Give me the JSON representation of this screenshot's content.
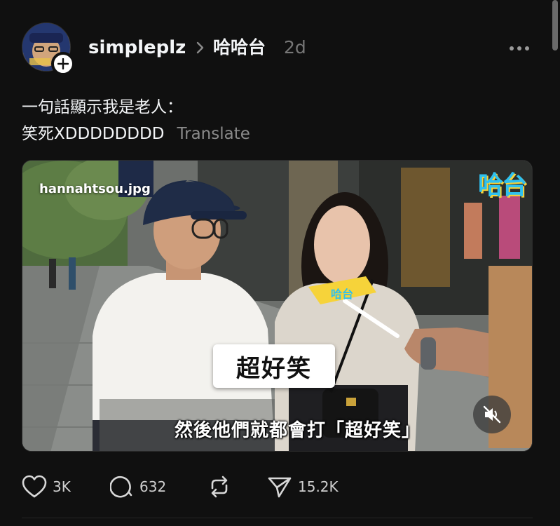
{
  "post": {
    "username": "simpleplz",
    "channel": "哈哈台",
    "timestamp": "2d",
    "text_line1": "一句話顯示我是老人：",
    "text_line2": "笑死XDDDDDDDD",
    "translate_label": "Translate"
  },
  "media": {
    "watermark": "hannahtsou.jpg",
    "channel_logo": "哈台",
    "caption": "超好笑",
    "subtitle": "然後他們就都會打「超好笑」"
  },
  "actions": {
    "likes": "3K",
    "replies": "632",
    "shares": "15.2K"
  },
  "icons": {
    "follow": "plus-icon",
    "breadcrumb": "chevron-right-icon",
    "more": "more-horizontal-icon",
    "mute": "volume-muted-icon",
    "like": "heart-icon",
    "reply": "comment-icon",
    "repost": "repost-icon",
    "share": "send-icon"
  },
  "colors": {
    "background": "#101010",
    "text_primary": "#f3f5f7",
    "text_muted": "#777777",
    "logo_blue": "#2ec0ef",
    "logo_yellow": "#f6d33a"
  }
}
